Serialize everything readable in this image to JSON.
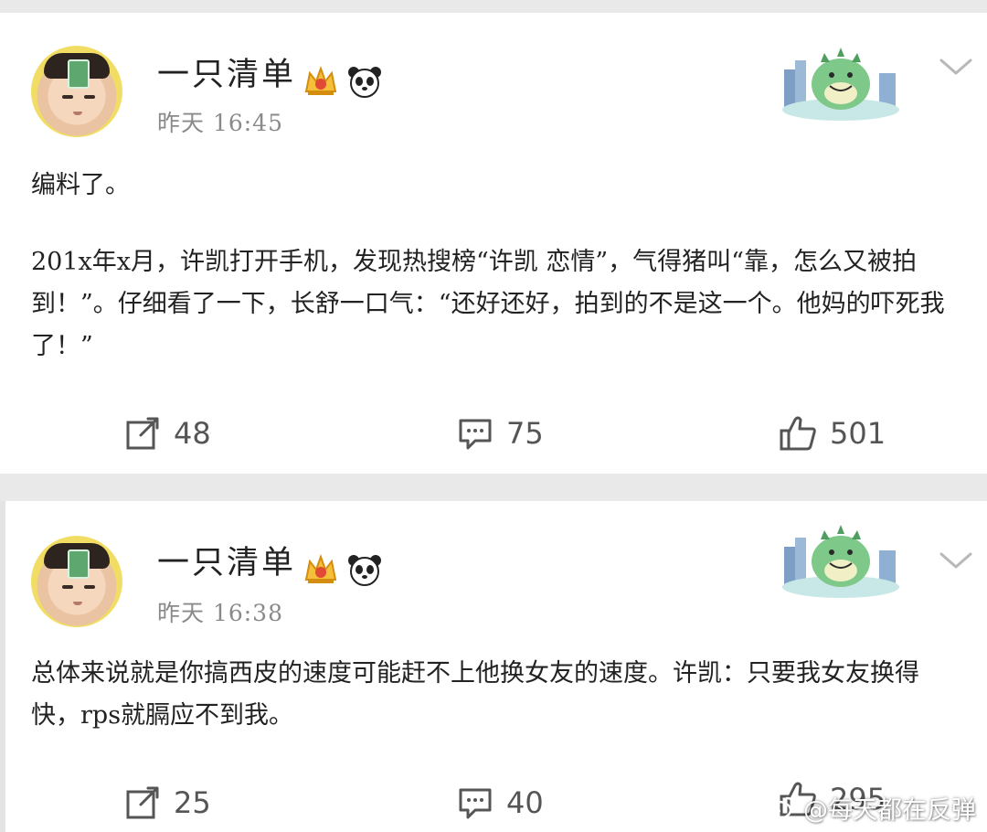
{
  "posts": [
    {
      "username": "一只清单",
      "time": "昨天 16:45",
      "paragraphs": [
        "编料了。",
        "201x年x月，许凯打开手机，发现热搜榜“许凯 恋情”，气得猪叫“靠，怎么又被拍到！”。仔细看了一下，长舒一口气：“还好还好，拍到的不是这一个。他妈的吓死我了！”"
      ],
      "actions": {
        "repost": "48",
        "comment": "75",
        "like": "501"
      }
    },
    {
      "username": "一只清单",
      "time": "昨天 16:38",
      "paragraphs": [
        "总体来说就是你搞西皮的速度可能赶不上他换女友的速度。许凯：只要我女友换得快，rps就膈应不到我。"
      ],
      "actions": {
        "repost": "25",
        "comment": "40",
        "like": "295"
      }
    }
  ],
  "watermark": "@每天都在反弹",
  "icons": {
    "repost": "repost-icon",
    "comment": "comment-icon",
    "like": "thumbs-up-icon",
    "more": "chevron-down-icon"
  }
}
